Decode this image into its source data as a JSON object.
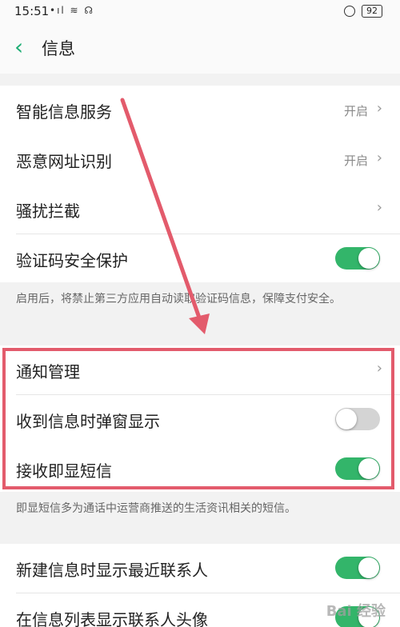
{
  "status_bar": {
    "time": "15:51",
    "signal_icons": "•ıl ≋ ☊",
    "battery": "92"
  },
  "header": {
    "title": "信息"
  },
  "settings": {
    "smart_service": {
      "label": "智能信息服务",
      "value": "开启"
    },
    "malicious_url": {
      "label": "恶意网址识别",
      "value": "开启"
    },
    "harassment_block": {
      "label": "骚扰拦截"
    },
    "code_protection": {
      "label": "验证码安全保护",
      "enabled": true
    }
  },
  "code_note": "启用后，将禁止第三方应用自动读取验证码信息，保障支付安全。",
  "notifications": {
    "manage": {
      "label": "通知管理"
    },
    "popup": {
      "label": "收到信息时弹窗显示",
      "enabled": false
    },
    "flash_sms": {
      "label": "接收即显短信",
      "enabled": true
    }
  },
  "flash_note": "即显短信多为通话中运营商推送的生活资讯相关的短信。",
  "contacts": {
    "recent": {
      "label": "新建信息时显示最近联系人",
      "enabled": true
    },
    "avatar": {
      "label": "在信息列表显示联系人头像",
      "enabled": true
    }
  },
  "watermark": "Bai 经验",
  "colors": {
    "accent": "#1fae75",
    "toggle_on": "#33b56a",
    "toggle_off": "#d4d4d4",
    "highlight": "#e35b6c"
  }
}
